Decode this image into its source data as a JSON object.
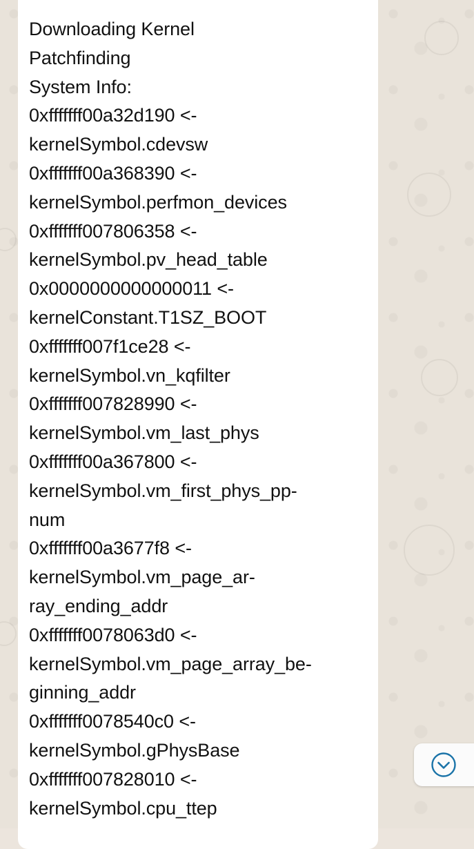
{
  "message": {
    "partial_top": "----",
    "lines": [
      "Downloading Kernel",
      "Patchfinding",
      "System Info:",
      "0xfffffff00a32d190 <-",
      "kernelSymbol.cdevsw",
      "0xfffffff00a368390 <-",
      "kernelSymbol.perfmon_devices",
      "0xfffffff007806358 <-",
      "kernelSymbol.pv_head_table",
      "0x0000000000000011 <-",
      "kernelConstant.T1SZ_BOOT",
      "0xfffffff007f1ce28 <-",
      "kernelSymbol.vn_kqfilter",
      "0xfffffff007828990 <-",
      "kernelSymbol.vm_last_phys",
      "0xfffffff00a367800 <-",
      "kernelSymbol.vm_first_phys_pp-",
      "num",
      "0xfffffff00a3677f8 <-",
      "kernelSymbol.vm_page_ar-",
      "ray_ending_addr",
      "0xfffffff0078063d0 <-",
      "kernelSymbol.vm_page_array_be-",
      "ginning_addr",
      "0xfffffff0078540c0 <-",
      "kernelSymbol.gPhysBase",
      "0xfffffff007828010 <-",
      "kernelSymbol.cpu_ttep"
    ]
  },
  "scroll_button": {
    "icon": "chevron-down-circle-icon",
    "accent_color": "#1a73a8"
  }
}
